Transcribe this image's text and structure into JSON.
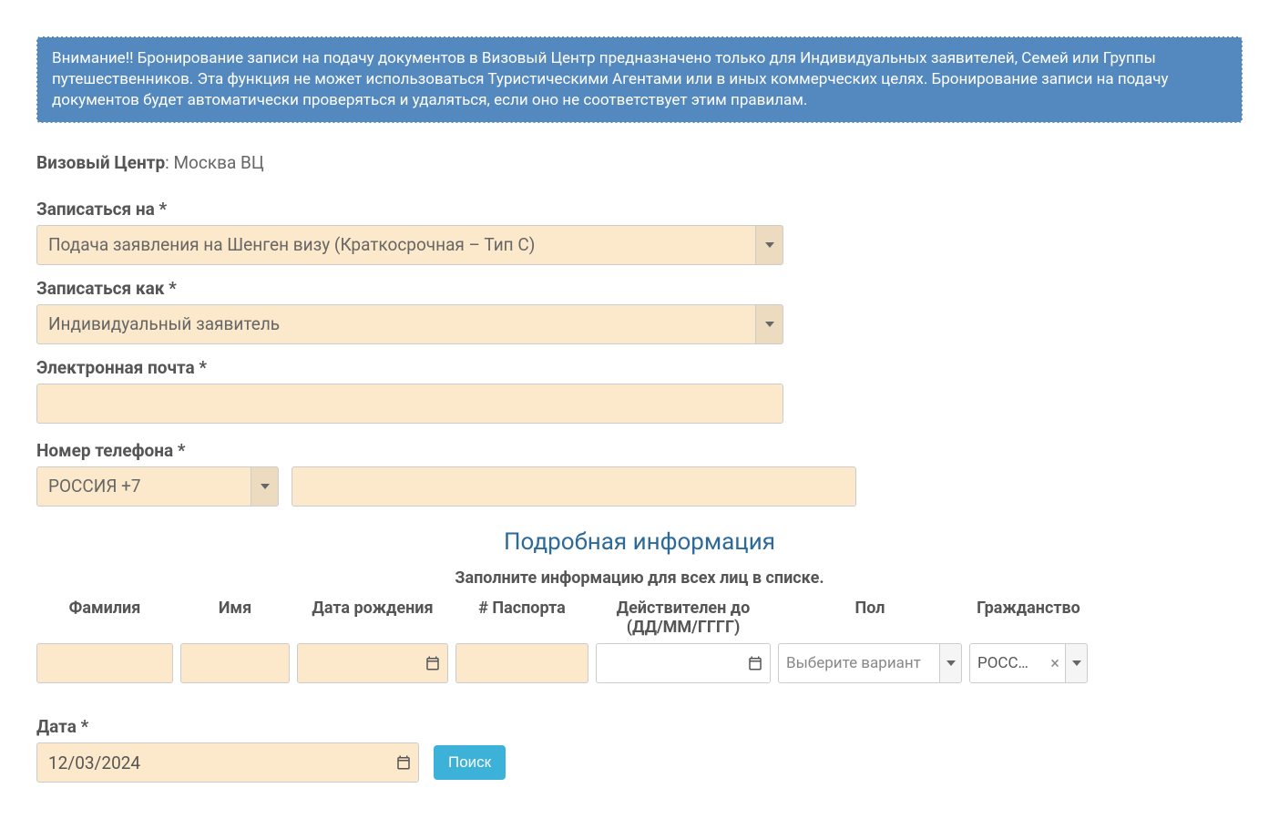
{
  "alert": "Внимание!! Бронирование записи на подачу документов в Визовый Центр предназначено только для Индивидуальных заявителей, Семей или Группы путешественников. Эта функция не может использоваться Туристическими Агентами или в иных коммерческих целях. Бронирование записи на подачу документов будет автоматически проверяться и удаляться, если оно не соответствует этим правилам.",
  "center": {
    "label": "Визовый Центр",
    "value": ": Москва ВЦ"
  },
  "form": {
    "signup_for": {
      "label": "Записаться на *",
      "value": "Подача заявления на Шенген визу (Краткосрочная – Тип C)"
    },
    "signup_as": {
      "label": "Записаться как *",
      "value": "Индивидуальный заявитель"
    },
    "email": {
      "label": "Электронная почта *",
      "value": ""
    },
    "phone": {
      "label": "Номер телефона *",
      "country": "РОССИЯ +7",
      "value": ""
    }
  },
  "details": {
    "title": "Подробная информация",
    "subtitle": "Заполните информацию для всех лиц в списке.",
    "columns": {
      "surname": "Фамилия",
      "name": "Имя",
      "dob": "Дата рождения",
      "passport": "# Паспорта",
      "valid_until": "Действителен до (ДД/ММ/ГГГГ)",
      "gender": "Пол",
      "citizenship": "Гражданство"
    },
    "row": {
      "surname": "",
      "name": "",
      "dob": "",
      "passport": "",
      "valid_until": "",
      "gender_placeholder": "Выберите вариант",
      "citizenship": "РОСС…"
    }
  },
  "date": {
    "label": "Дата *",
    "value": "12/03/2024"
  },
  "search_label": "Поиск"
}
